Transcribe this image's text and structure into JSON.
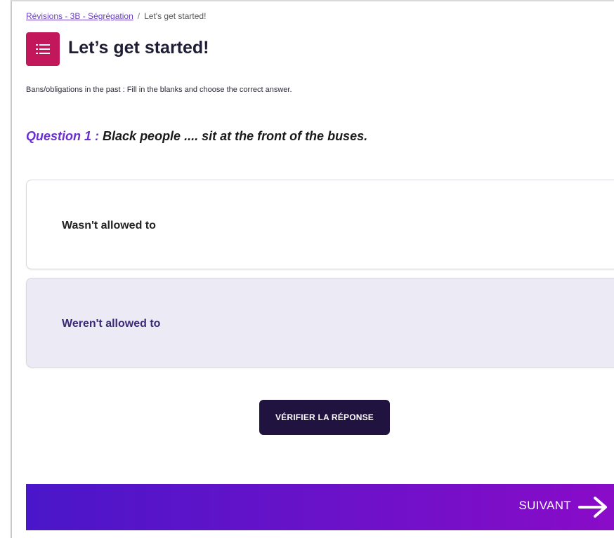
{
  "breadcrumb": {
    "parent": "Révisions - 3B - Ségrégation",
    "separator": "/",
    "current": "Let's get started!"
  },
  "header": {
    "icon": "list-icon",
    "icon_color": "#c2185b",
    "title": "Let’s get started!"
  },
  "instruction": "Bans/obligations in the past : Fill in the blanks and choose the correct answer.",
  "question": {
    "label": "Question 1 :",
    "text": "Black people .... sit at the front of the buses."
  },
  "options": [
    {
      "label": "Wasn't allowed to",
      "selected": false
    },
    {
      "label": "Weren't allowed to",
      "selected": true
    }
  ],
  "verify_button": {
    "label": "VÉRIFIER LA RÉPONSE"
  },
  "next": {
    "label": "SUIVANT",
    "icon": "arrow-right-icon"
  },
  "colors": {
    "accent": "#6a2fd1",
    "button_dark": "#20133f",
    "selected_bg": "#ecebf5"
  }
}
